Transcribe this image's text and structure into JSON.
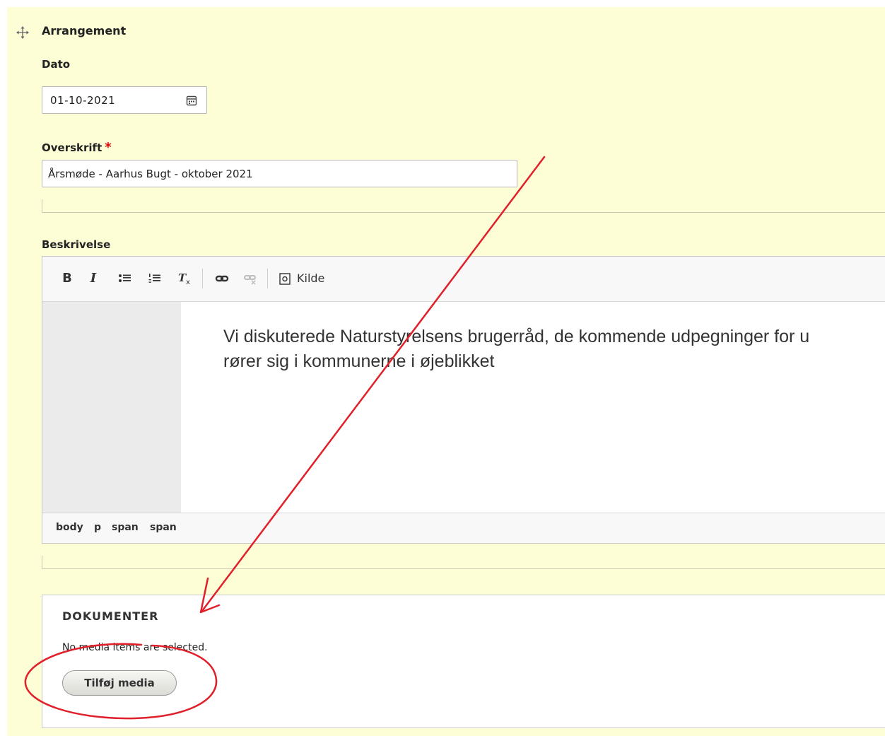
{
  "section": {
    "title": "Arrangement",
    "drag_icon": "move-arrows-icon"
  },
  "date_field": {
    "label": "Dato",
    "value": "01-10-2021",
    "icon": "calendar-icon"
  },
  "heading_field": {
    "label": "Overskrift",
    "required_marker": "*",
    "value": "Årsmøde - Aarhus Bugt - oktober 2021"
  },
  "description_field": {
    "label": "Beskrivelse",
    "toolbar": {
      "bold": "B",
      "italic": "I",
      "bullet_list_icon": "bulleted-list-icon",
      "numbered_list_icon": "numbered-list-icon",
      "remove_format": "Tx",
      "link_icon": "link-icon",
      "unlink_icon": "unlink-icon",
      "source_icon": "source-icon",
      "source_label": "Kilde"
    },
    "body_line1": "Vi diskuterede Naturstyrelsens brugerråd, de kommende udpegninger for u",
    "body_line2": "rører sig i kommunerne i øjeblikket",
    "path": [
      "body",
      "p",
      "span",
      "span"
    ]
  },
  "documents": {
    "title": "DOKUMENTER",
    "empty_text": "No media items are selected.",
    "add_button": "Tilføj media"
  },
  "annotation": {
    "color": "#e0202a"
  }
}
